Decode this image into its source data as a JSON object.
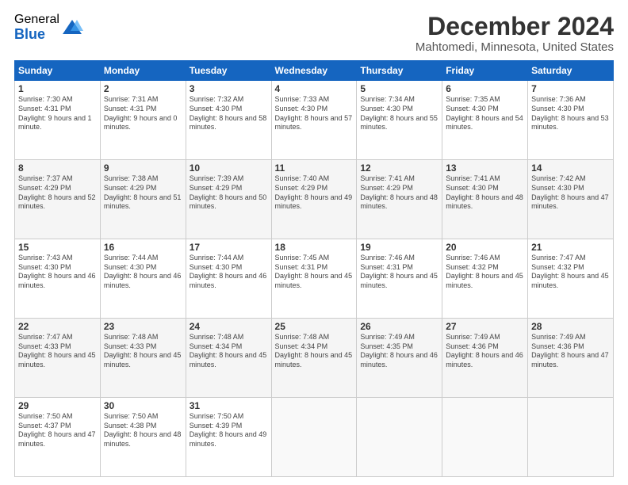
{
  "logo": {
    "general": "General",
    "blue": "Blue"
  },
  "header": {
    "title": "December 2024",
    "subtitle": "Mahtomedi, Minnesota, United States"
  },
  "weekdays": [
    "Sunday",
    "Monday",
    "Tuesday",
    "Wednesday",
    "Thursday",
    "Friday",
    "Saturday"
  ],
  "weeks": [
    [
      {
        "day": "1",
        "sunrise": "7:30 AM",
        "sunset": "4:31 PM",
        "daylight": "9 hours and 1 minute."
      },
      {
        "day": "2",
        "sunrise": "7:31 AM",
        "sunset": "4:31 PM",
        "daylight": "9 hours and 0 minutes."
      },
      {
        "day": "3",
        "sunrise": "7:32 AM",
        "sunset": "4:30 PM",
        "daylight": "8 hours and 58 minutes."
      },
      {
        "day": "4",
        "sunrise": "7:33 AM",
        "sunset": "4:30 PM",
        "daylight": "8 hours and 57 minutes."
      },
      {
        "day": "5",
        "sunrise": "7:34 AM",
        "sunset": "4:30 PM",
        "daylight": "8 hours and 55 minutes."
      },
      {
        "day": "6",
        "sunrise": "7:35 AM",
        "sunset": "4:30 PM",
        "daylight": "8 hours and 54 minutes."
      },
      {
        "day": "7",
        "sunrise": "7:36 AM",
        "sunset": "4:30 PM",
        "daylight": "8 hours and 53 minutes."
      }
    ],
    [
      {
        "day": "8",
        "sunrise": "7:37 AM",
        "sunset": "4:29 PM",
        "daylight": "8 hours and 52 minutes."
      },
      {
        "day": "9",
        "sunrise": "7:38 AM",
        "sunset": "4:29 PM",
        "daylight": "8 hours and 51 minutes."
      },
      {
        "day": "10",
        "sunrise": "7:39 AM",
        "sunset": "4:29 PM",
        "daylight": "8 hours and 50 minutes."
      },
      {
        "day": "11",
        "sunrise": "7:40 AM",
        "sunset": "4:29 PM",
        "daylight": "8 hours and 49 minutes."
      },
      {
        "day": "12",
        "sunrise": "7:41 AM",
        "sunset": "4:29 PM",
        "daylight": "8 hours and 48 minutes."
      },
      {
        "day": "13",
        "sunrise": "7:41 AM",
        "sunset": "4:30 PM",
        "daylight": "8 hours and 48 minutes."
      },
      {
        "day": "14",
        "sunrise": "7:42 AM",
        "sunset": "4:30 PM",
        "daylight": "8 hours and 47 minutes."
      }
    ],
    [
      {
        "day": "15",
        "sunrise": "7:43 AM",
        "sunset": "4:30 PM",
        "daylight": "8 hours and 46 minutes."
      },
      {
        "day": "16",
        "sunrise": "7:44 AM",
        "sunset": "4:30 PM",
        "daylight": "8 hours and 46 minutes."
      },
      {
        "day": "17",
        "sunrise": "7:44 AM",
        "sunset": "4:30 PM",
        "daylight": "8 hours and 46 minutes."
      },
      {
        "day": "18",
        "sunrise": "7:45 AM",
        "sunset": "4:31 PM",
        "daylight": "8 hours and 45 minutes."
      },
      {
        "day": "19",
        "sunrise": "7:46 AM",
        "sunset": "4:31 PM",
        "daylight": "8 hours and 45 minutes."
      },
      {
        "day": "20",
        "sunrise": "7:46 AM",
        "sunset": "4:32 PM",
        "daylight": "8 hours and 45 minutes."
      },
      {
        "day": "21",
        "sunrise": "7:47 AM",
        "sunset": "4:32 PM",
        "daylight": "8 hours and 45 minutes."
      }
    ],
    [
      {
        "day": "22",
        "sunrise": "7:47 AM",
        "sunset": "4:33 PM",
        "daylight": "8 hours and 45 minutes."
      },
      {
        "day": "23",
        "sunrise": "7:48 AM",
        "sunset": "4:33 PM",
        "daylight": "8 hours and 45 minutes."
      },
      {
        "day": "24",
        "sunrise": "7:48 AM",
        "sunset": "4:34 PM",
        "daylight": "8 hours and 45 minutes."
      },
      {
        "day": "25",
        "sunrise": "7:48 AM",
        "sunset": "4:34 PM",
        "daylight": "8 hours and 45 minutes."
      },
      {
        "day": "26",
        "sunrise": "7:49 AM",
        "sunset": "4:35 PM",
        "daylight": "8 hours and 46 minutes."
      },
      {
        "day": "27",
        "sunrise": "7:49 AM",
        "sunset": "4:36 PM",
        "daylight": "8 hours and 46 minutes."
      },
      {
        "day": "28",
        "sunrise": "7:49 AM",
        "sunset": "4:36 PM",
        "daylight": "8 hours and 47 minutes."
      }
    ],
    [
      {
        "day": "29",
        "sunrise": "7:50 AM",
        "sunset": "4:37 PM",
        "daylight": "8 hours and 47 minutes."
      },
      {
        "day": "30",
        "sunrise": "7:50 AM",
        "sunset": "4:38 PM",
        "daylight": "8 hours and 48 minutes."
      },
      {
        "day": "31",
        "sunrise": "7:50 AM",
        "sunset": "4:39 PM",
        "daylight": "8 hours and 49 minutes."
      },
      null,
      null,
      null,
      null
    ]
  ],
  "labels": {
    "sunrise": "Sunrise:",
    "sunset": "Sunset:",
    "daylight": "Daylight:"
  }
}
